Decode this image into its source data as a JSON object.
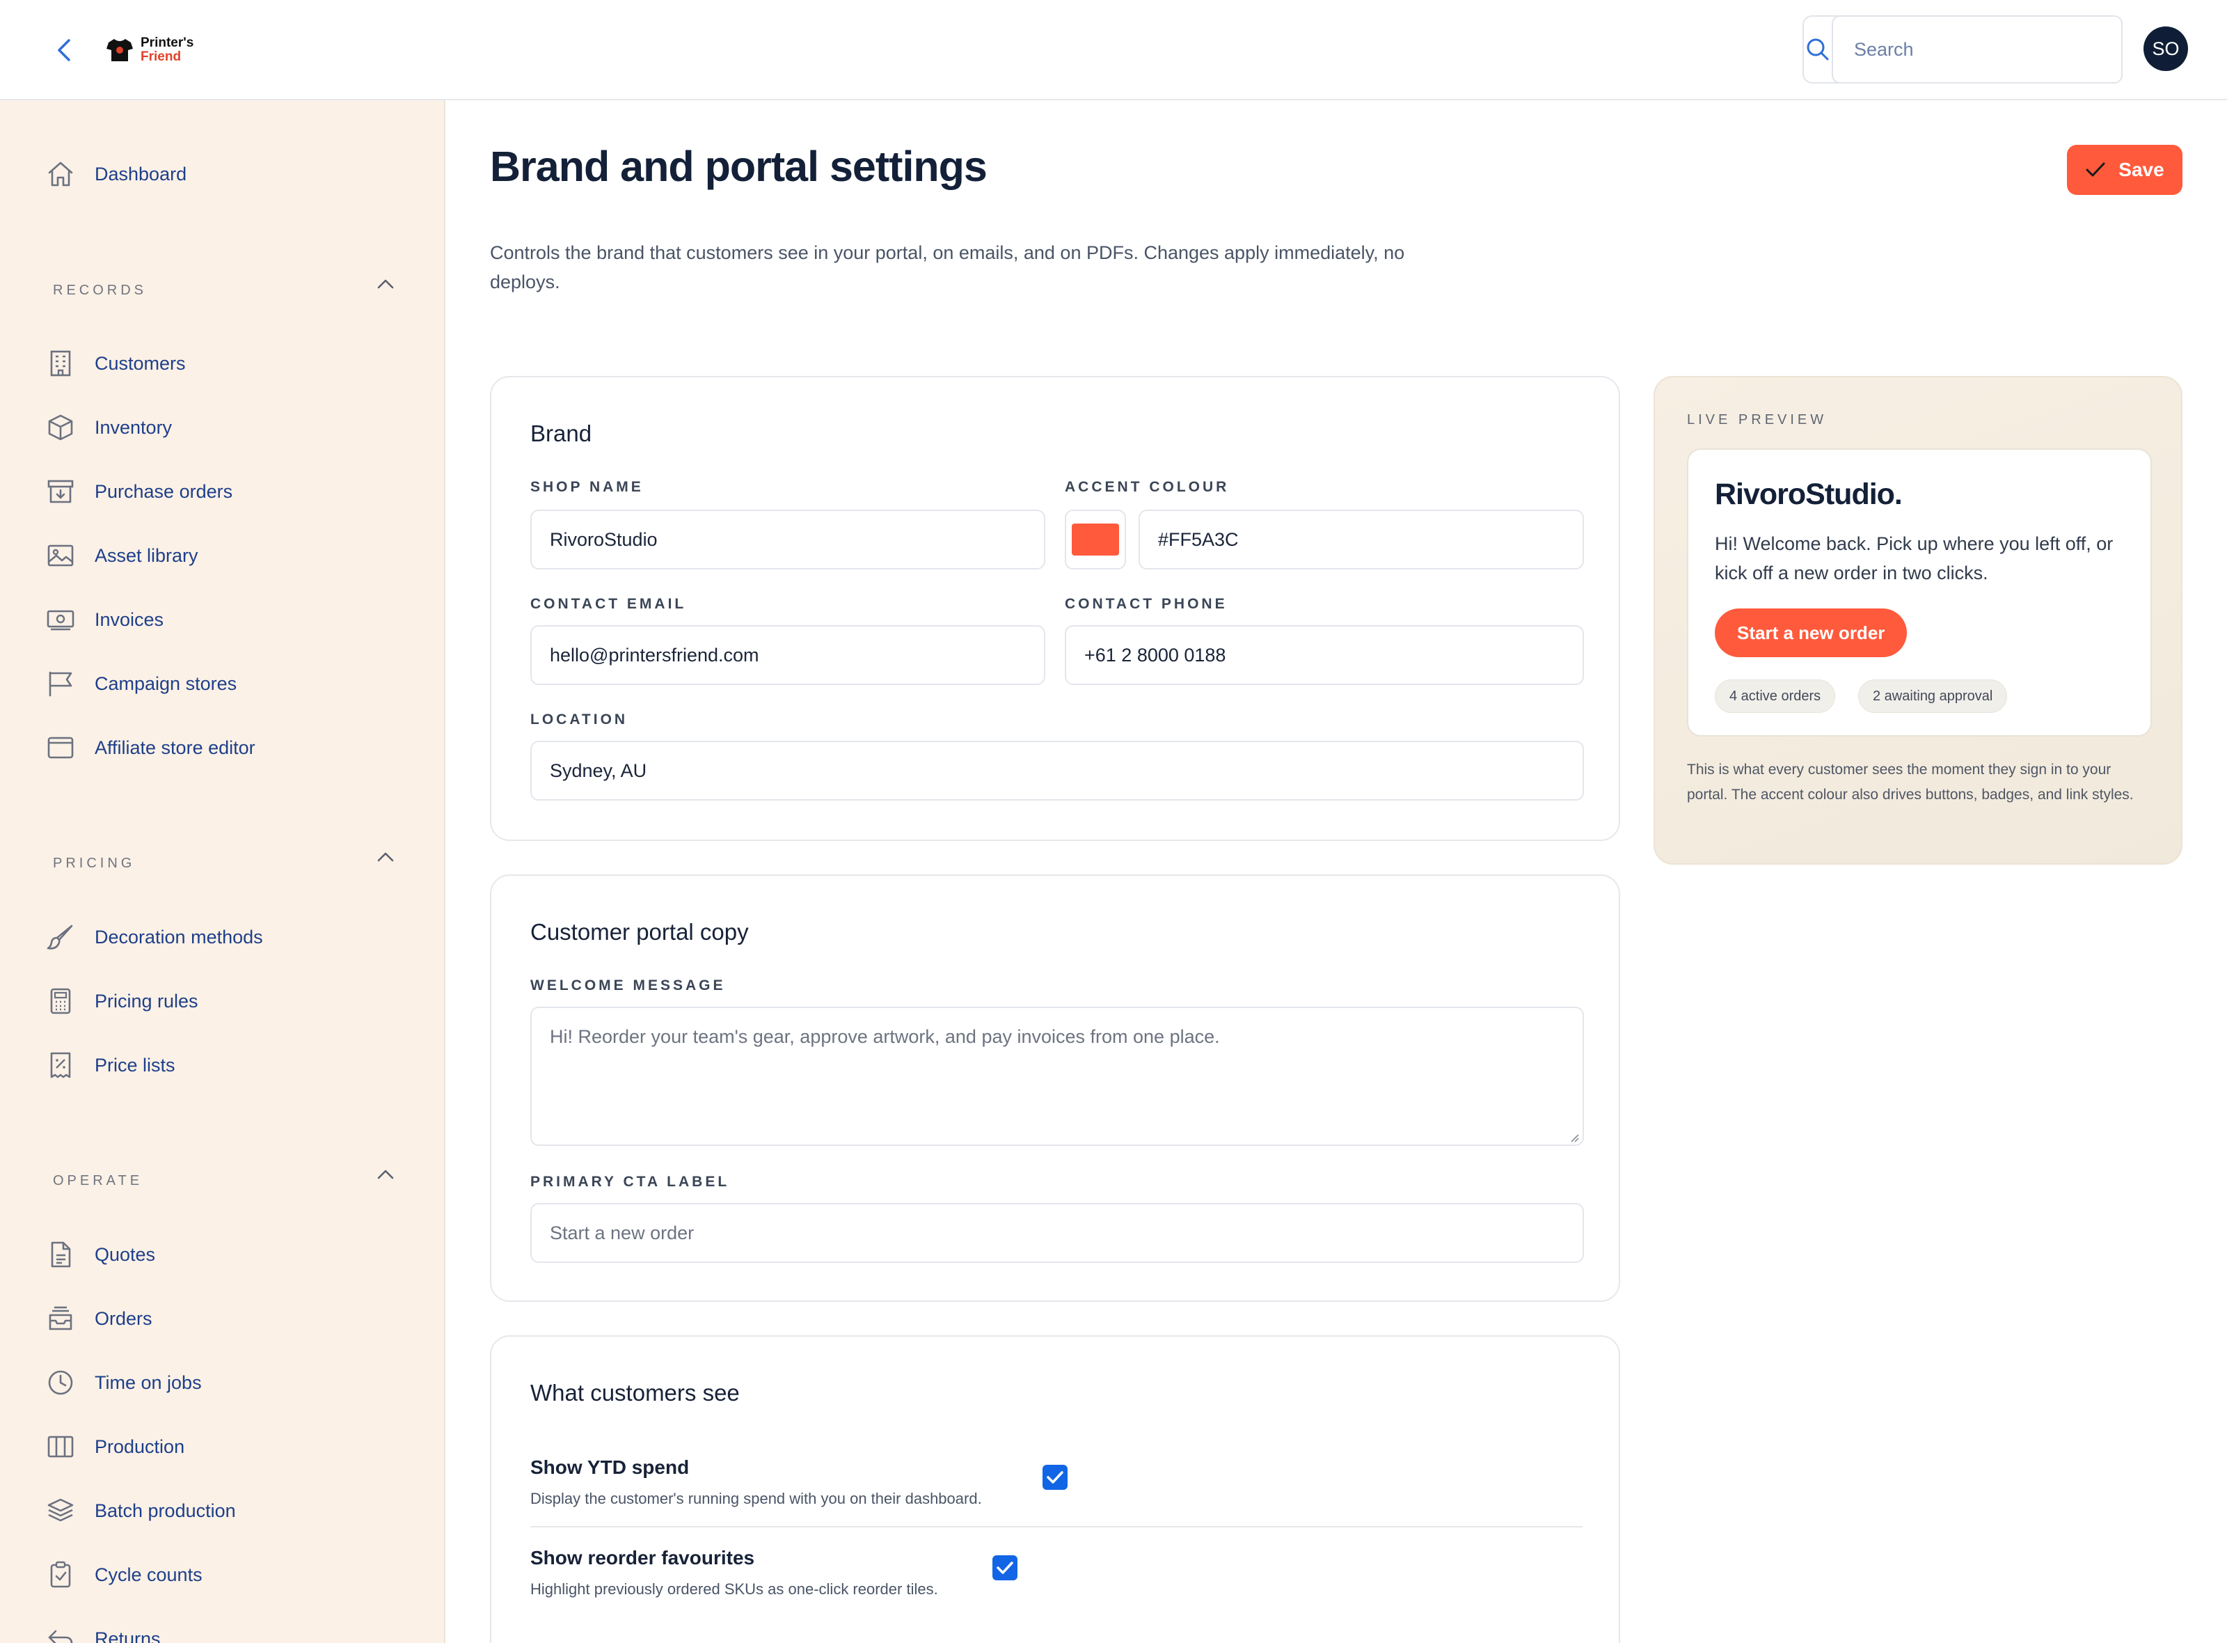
{
  "header": {
    "logo_line1": "Printer's",
    "logo_line2": "Friend",
    "search_placeholder": "Search",
    "avatar_initials": "SO"
  },
  "sidebar": {
    "dashboard": "Dashboard",
    "sections": [
      {
        "label": "RECORDS",
        "items": [
          "Customers",
          "Inventory",
          "Purchase orders",
          "Asset library",
          "Invoices",
          "Campaign stores",
          "Affiliate store editor"
        ]
      },
      {
        "label": "PRICING",
        "items": [
          "Decoration methods",
          "Pricing rules",
          "Price lists"
        ]
      },
      {
        "label": "OPERATE",
        "items": [
          "Quotes",
          "Orders",
          "Time on jobs",
          "Production",
          "Batch production",
          "Cycle counts",
          "Returns"
        ]
      }
    ]
  },
  "page": {
    "title": "Brand and portal settings",
    "save_label": "Save",
    "description": "Controls the brand that customers see in your portal, on emails, and on PDFs. Changes apply immediately, no deploys."
  },
  "brand": {
    "title": "Brand",
    "shop_name_label": "SHOP NAME",
    "shop_name": "RivoroStudio",
    "accent_label": "ACCENT COLOUR",
    "accent_value": "#FF5A3C",
    "contact_email_label": "CONTACT EMAIL",
    "contact_email": "hello@printersfriend.com",
    "contact_phone_label": "CONTACT PHONE",
    "contact_phone": "+61 2 8000 0188",
    "location_label": "LOCATION",
    "location": "Sydney, AU"
  },
  "portal_copy": {
    "title": "Customer portal copy",
    "welcome_label": "WELCOME MESSAGE",
    "welcome_placeholder": "Hi! Reorder your team's gear, approve artwork, and pay invoices from one place.",
    "cta_label": "PRIMARY CTA LABEL",
    "cta_placeholder": "Start a new order"
  },
  "visibility": {
    "title": "What customers see",
    "toggles": [
      {
        "title": "Show YTD spend",
        "desc": "Display the customer's running spend with you on their dashboard.",
        "checked": true
      },
      {
        "title": "Show reorder favourites",
        "desc": "Highlight previously ordered SKUs as one-click reorder tiles.",
        "checked": true
      }
    ]
  },
  "preview": {
    "label": "LIVE PREVIEW",
    "brand": "RivoroStudio.",
    "welcome": "Hi! Welcome back. Pick up where you left off, or kick off a new order in two clicks.",
    "cta": "Start a new order",
    "chips": [
      "4 active orders",
      "2 awaiting approval"
    ],
    "footnote": "This is what every customer sees the moment they sign in to your portal. The accent colour also drives buttons, badges, and link styles."
  },
  "colors": {
    "accent": "#FF5A3C",
    "nav_text": "#1E3F8A",
    "sidebar_bg": "#FBF1E6",
    "checkbox": "#1266E6",
    "avatar_bg": "#0F1E36"
  }
}
